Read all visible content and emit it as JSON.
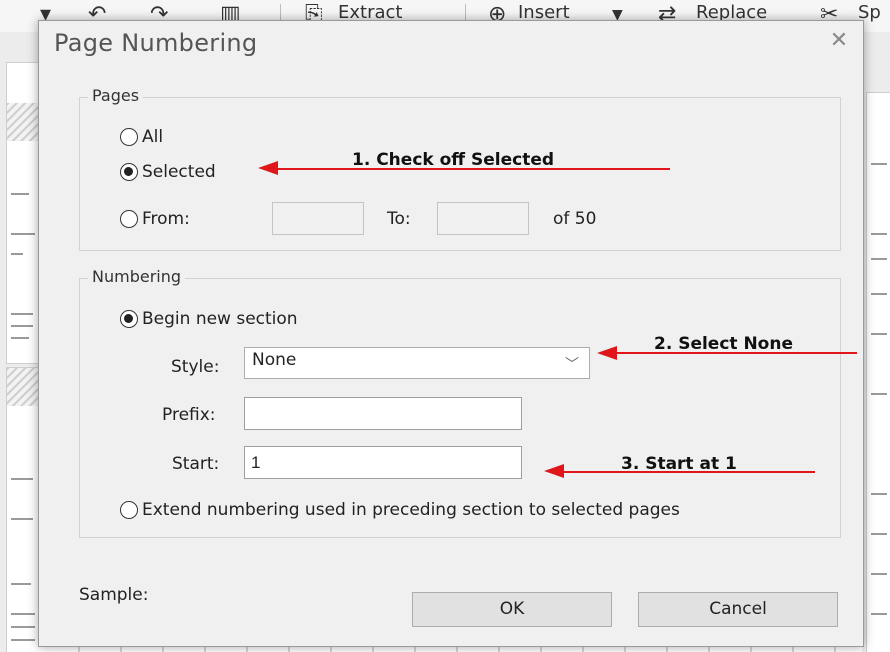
{
  "toolbar": {
    "extract_label": "Extract",
    "insert_label": "Insert",
    "replace_label": "Replace",
    "split_label": "Sp"
  },
  "dialog": {
    "title": "Page Numbering",
    "close_symbol": "✕",
    "pages": {
      "legend": "Pages",
      "all_label": "All",
      "selected_label": "Selected",
      "from_label": "From:",
      "from_value": "",
      "to_label": "To:",
      "to_value": "",
      "of_total": "of 50",
      "selected_option": "Selected"
    },
    "numbering": {
      "legend": "Numbering",
      "begin_new_section_label": "Begin new section",
      "style_label": "Style:",
      "style_value": "None",
      "prefix_label": "Prefix:",
      "prefix_value": "",
      "start_label": "Start:",
      "start_value": "1",
      "extend_label": "Extend numbering used in preceding section to selected pages",
      "selected_option": "Begin new section"
    },
    "sample_label": "Sample:",
    "ok_label": "OK",
    "cancel_label": "Cancel"
  },
  "annotations": {
    "step1": "1. Check off Selected",
    "step2": "2. Select None",
    "step3": "3. Start at 1",
    "arrow_color": "#e0161b"
  }
}
